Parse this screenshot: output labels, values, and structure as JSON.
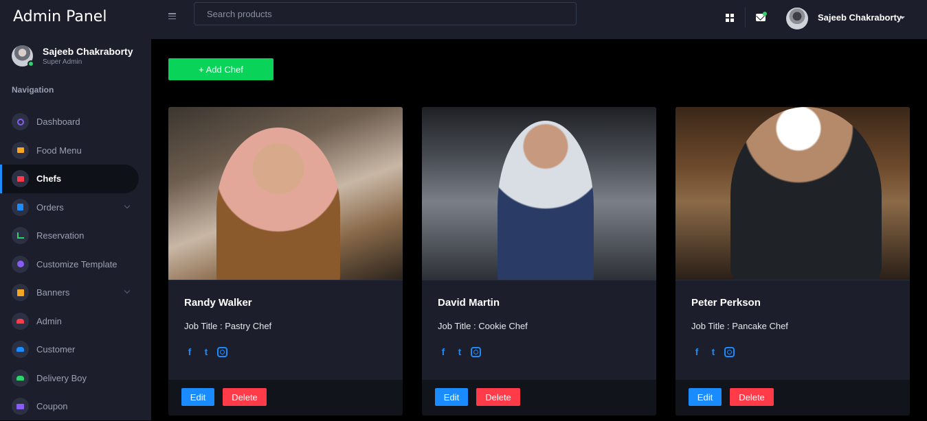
{
  "app": {
    "title": "Admin Panel"
  },
  "sidebar": {
    "user": {
      "name": "Sajeeb Chakraborty",
      "role": "Super Admin"
    },
    "nav_heading": "Navigation",
    "items": [
      {
        "label": "Dashboard",
        "icon": "dashboard-icon",
        "color": "#8a5cf6"
      },
      {
        "label": "Food Menu",
        "icon": "food-menu-icon",
        "color": "#f5a623"
      },
      {
        "label": "Chefs",
        "icon": "chefs-icon",
        "color": "#ff3b4a",
        "active": true
      },
      {
        "label": "Orders",
        "icon": "orders-icon",
        "color": "#1a8cff",
        "has_submenu": true
      },
      {
        "label": "Reservation",
        "icon": "reservation-icon",
        "color": "#2fd36e"
      },
      {
        "label": "Customize Template",
        "icon": "gear-icon",
        "color": "#8a5cf6"
      },
      {
        "label": "Banners",
        "icon": "banners-icon",
        "color": "#f5a623",
        "has_submenu": true
      },
      {
        "label": "Admin",
        "icon": "admin-icon",
        "color": "#ff3b4a"
      },
      {
        "label": "Customer",
        "icon": "customer-icon",
        "color": "#1a8cff"
      },
      {
        "label": "Delivery Boy",
        "icon": "delivery-boy-icon",
        "color": "#2fd36e"
      },
      {
        "label": "Coupon",
        "icon": "coupon-icon",
        "color": "#8a5cf6"
      }
    ]
  },
  "topbar": {
    "search_placeholder": "Search products",
    "user_name": "Sajeeb Chakraborty"
  },
  "main": {
    "add_button_label": "+ Add Chef",
    "chefs": [
      {
        "name": "Randy Walker",
        "job": "Job Title : Pastry Chef"
      },
      {
        "name": "David Martin",
        "job": "Job Title : Cookie Chef"
      },
      {
        "name": "Peter Perkson",
        "job": "Job Title : Pancake Chef"
      }
    ],
    "edit_label": "Edit",
    "delete_label": "Delete"
  },
  "colors": {
    "accent": "#1a8cff",
    "success": "#0ad35a",
    "danger": "#ff3b4a",
    "panel": "#1c1f2b"
  }
}
